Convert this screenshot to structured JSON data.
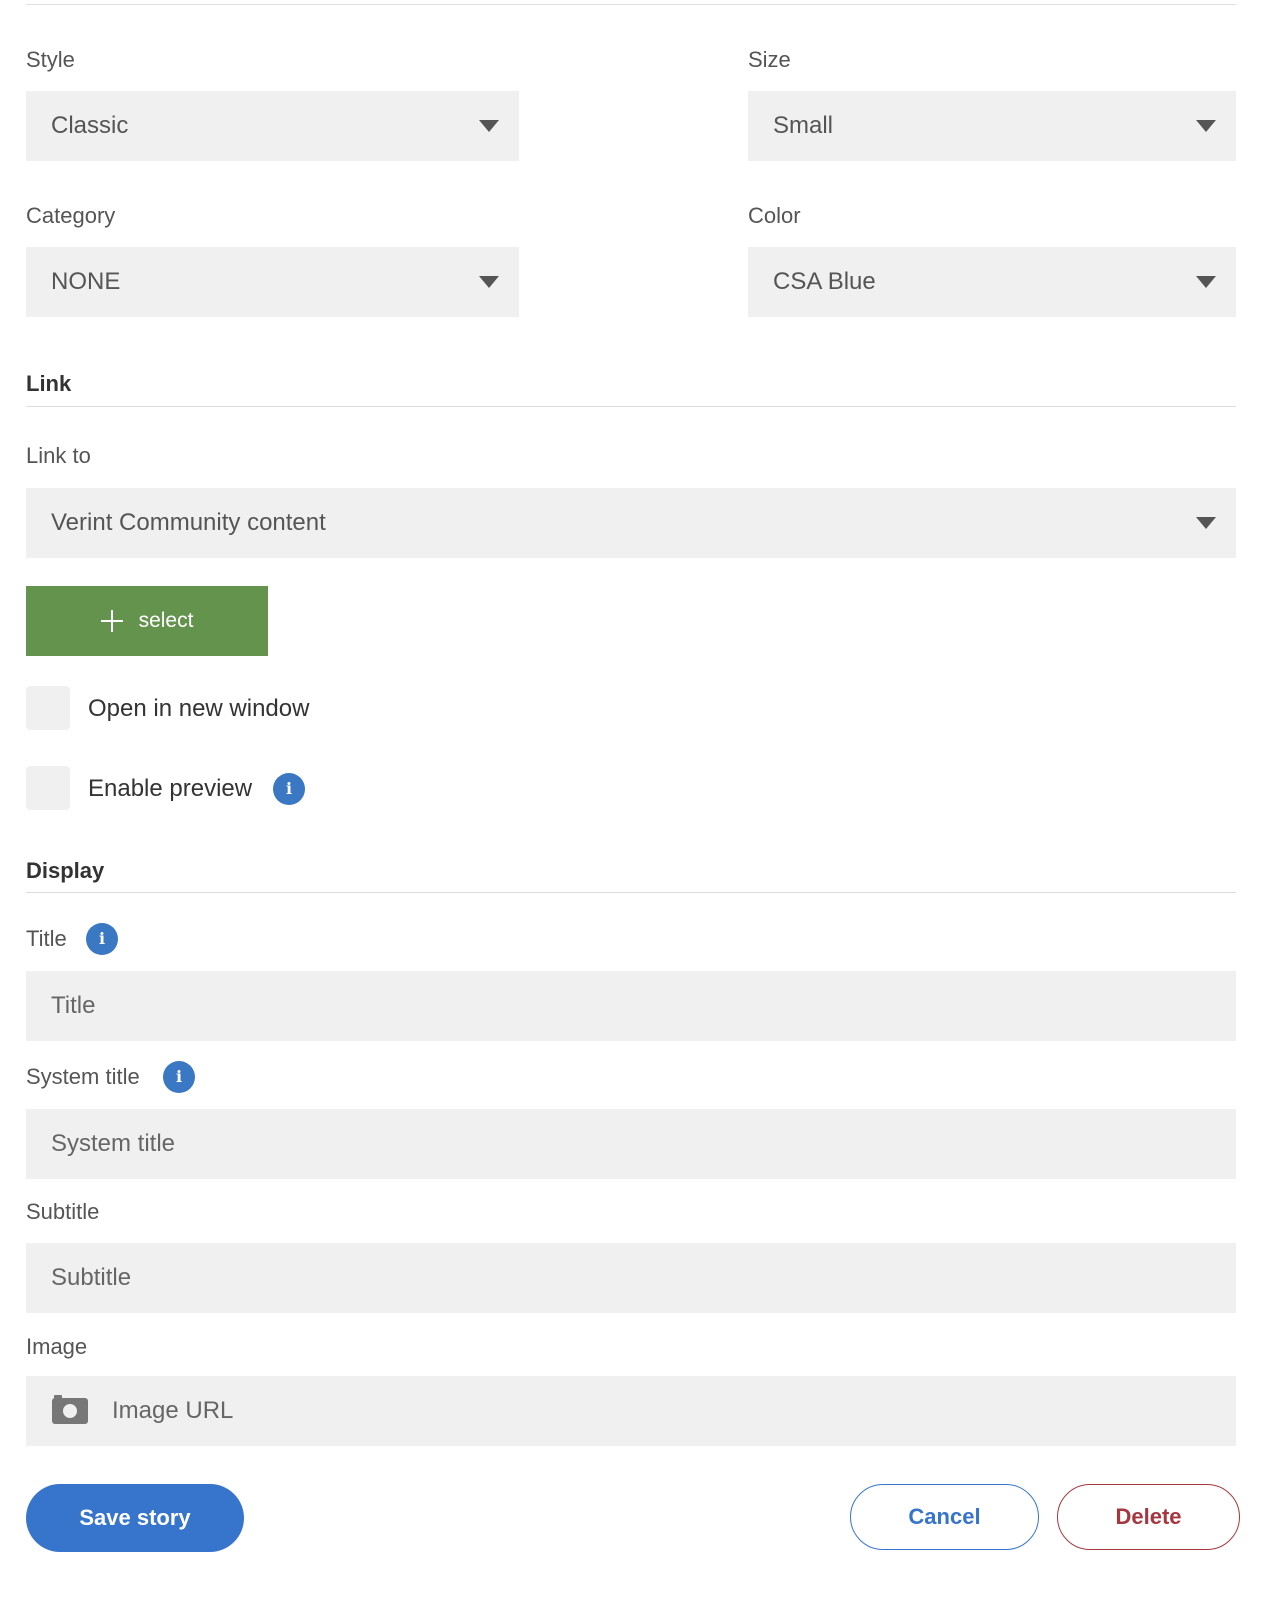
{
  "style": {
    "label": "Style",
    "value": "Classic"
  },
  "size": {
    "label": "Size",
    "value": "Small"
  },
  "category": {
    "label": "Category",
    "value": "NONE"
  },
  "color": {
    "label": "Color",
    "value": "CSA Blue"
  },
  "link": {
    "heading": "Link",
    "link_to_label": "Link to",
    "link_to_value": "Verint Community content",
    "select_button": "select",
    "open_new_window": "Open in new window",
    "enable_preview": "Enable preview"
  },
  "display": {
    "heading": "Display",
    "title_label": "Title",
    "title_placeholder": "Title",
    "system_title_label": "System title",
    "system_title_placeholder": "System title",
    "subtitle_label": "Subtitle",
    "subtitle_placeholder": "Subtitle",
    "image_label": "Image",
    "image_placeholder": "Image URL"
  },
  "actions": {
    "save": "Save story",
    "cancel": "Cancel",
    "delete": "Delete"
  },
  "info_glyph": "i",
  "colors": {
    "save": "#3774cb",
    "select_button": "#64934e",
    "delete": "#a6373f",
    "info": "#3a78c3",
    "field_bg": "#f0f0f0"
  }
}
